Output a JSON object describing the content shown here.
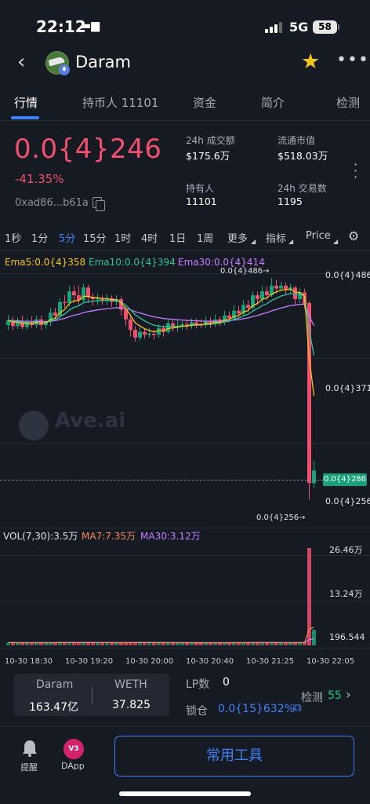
{
  "status_bar": {
    "time": "22:12",
    "network": "5G",
    "battery": "58"
  },
  "header": {
    "title": "Daram"
  },
  "tabs": [
    {
      "label": "行情"
    },
    {
      "label": "持币人 11101"
    },
    {
      "label": "资金"
    },
    {
      "label": "简介"
    },
    {
      "label": "检测"
    }
  ],
  "token": {
    "price": "0.0{4}246",
    "change": "-41.35%",
    "address": "0xad86...b61a"
  },
  "stats": {
    "volume_24h_label": "24h 成交额",
    "volume_24h": "$175.6万",
    "market_cap_label": "流通市值",
    "market_cap": "$518.03万",
    "holders_label": "持有人",
    "holders": "11101",
    "tx_24h_label": "24h 交易数",
    "tx_24h": "1195"
  },
  "timeframes": [
    "1秒",
    "1分",
    "5分",
    "15分",
    "1时",
    "4时",
    "1日",
    "1周",
    "更多",
    "指标",
    "Price"
  ],
  "active_timeframe": "5分",
  "chart_legend": {
    "ema5": "Ema5:0.0{4}358",
    "ema10": "Ema10:0.0{4}394",
    "ema30": "Ema30:0.0{4}414"
  },
  "price_axis": {
    "top": "0.0{4}486",
    "mid": "0.0{4}371",
    "bottom": "0.0{4}256",
    "current": "0.0{4}286"
  },
  "annotations": {
    "high": "0.0{4}486→",
    "low": "0.0{4}256→"
  },
  "watermark": "Ave.ai",
  "volume_legend": {
    "vol": "VOL(7,30):3.5万",
    "ma7": "MA7:7.35万",
    "ma30": "MA30:3.12万"
  },
  "volume_axis": {
    "top": "26.46万",
    "mid": "13.24万",
    "bottom": "196.544"
  },
  "time_axis": [
    "10-30 18:30",
    "10-30 19:20",
    "10-30 20:00",
    "10-30 20:40",
    "10-30 21:25",
    "10-30 22:05"
  ],
  "pool": {
    "token_a_label": "Daram",
    "token_a_value": "163.47亿",
    "token_b_label": "WETH",
    "token_b_value": "37.825",
    "lp_label": "LP数",
    "lp_value": "0",
    "lock_label": "锁仓",
    "lock_value": "0.0{15}632%",
    "check_label": "检测",
    "check_value": "55"
  },
  "bottom_nav": {
    "alert_label": "提醒",
    "dapp_label": "DApp",
    "dapp_badge": "V3",
    "tools_button": "常用工具"
  },
  "colors": {
    "up": "#16a37a",
    "down": "#f0506e",
    "accent": "#3b82f6",
    "ema5": "#f5c518",
    "ema10": "#2ec4a0",
    "ema30": "#c77dff"
  },
  "chart_data": {
    "type": "candlestick",
    "candles": [
      [
        4.37e-05,
        4.42e-05,
        4.48e-05,
        4.32e-05
      ],
      [
        4.42e-05,
        4.36e-05,
        4.46e-05,
        4.32e-05
      ],
      [
        4.36e-05,
        4.41e-05,
        4.45e-05,
        4.33e-05
      ],
      [
        4.41e-05,
        4.35e-05,
        4.47e-05,
        4.33e-05
      ],
      [
        4.35e-05,
        4.4e-05,
        4.44e-05,
        4.32e-05
      ],
      [
        4.4e-05,
        4.37e-05,
        4.46e-05,
        4.34e-05
      ],
      [
        4.37e-05,
        4.43e-05,
        4.47e-05,
        4.34e-05
      ],
      [
        4.43e-05,
        4.37e-05,
        4.47e-05,
        4.32e-05
      ],
      [
        4.37e-05,
        4.4e-05,
        4.43e-05,
        4.33e-05
      ],
      [
        4.4e-05,
        4.5e-05,
        4.55e-05,
        4.36e-05
      ],
      [
        4.5e-05,
        4.47e-05,
        4.55e-05,
        4.43e-05
      ],
      [
        4.47e-05,
        4.61e-05,
        4.65e-05,
        4.44e-05
      ],
      [
        4.61e-05,
        4.6e-05,
        4.68e-05,
        4.55e-05
      ],
      [
        4.6e-05,
        4.72e-05,
        4.78e-05,
        4.56e-05
      ],
      [
        4.72e-05,
        4.68e-05,
        4.78e-05,
        4.6e-05
      ],
      [
        4.68e-05,
        4.63e-05,
        4.78e-05,
        4.58e-05
      ],
      [
        4.63e-05,
        4.76e-05,
        4.8e-05,
        4.6e-05
      ],
      [
        4.76e-05,
        4.66e-05,
        4.79e-05,
        4.6e-05
      ],
      [
        4.66e-05,
        4.64e-05,
        4.7e-05,
        4.57e-05
      ],
      [
        4.64e-05,
        4.65e-05,
        4.7e-05,
        4.58e-05
      ],
      [
        4.65e-05,
        4.62e-05,
        4.68e-05,
        4.58e-05
      ],
      [
        4.62e-05,
        4.65e-05,
        4.69e-05,
        4.58e-05
      ],
      [
        4.65e-05,
        4.61e-05,
        4.68e-05,
        4.56e-05
      ],
      [
        4.61e-05,
        4.64e-05,
        4.68e-05,
        4.57e-05
      ],
      [
        4.64e-05,
        4.53e-05,
        4.67e-05,
        4.47e-05
      ],
      [
        4.53e-05,
        4.43e-05,
        4.56e-05,
        4.36e-05
      ],
      [
        4.43e-05,
        4.32e-05,
        4.47e-05,
        4.25e-05
      ],
      [
        4.32e-05,
        4.24e-05,
        4.36e-05,
        4.2e-05
      ],
      [
        4.24e-05,
        4.3e-05,
        4.35e-05,
        4.21e-05
      ],
      [
        4.3e-05,
        4.27e-05,
        4.34e-05,
        4.23e-05
      ],
      [
        4.27e-05,
        4.28e-05,
        4.34e-05,
        4.24e-05
      ],
      [
        4.28e-05,
        4.27e-05,
        4.32e-05,
        4.22e-05
      ],
      [
        4.27e-05,
        4.34e-05,
        4.38e-05,
        4.24e-05
      ],
      [
        4.34e-05,
        4.3e-05,
        4.37e-05,
        4.25e-05
      ],
      [
        4.3e-05,
        4.39e-05,
        4.44e-05,
        4.28e-05
      ],
      [
        4.39e-05,
        4.35e-05,
        4.42e-05,
        4.3e-05
      ],
      [
        4.35e-05,
        4.36e-05,
        4.42e-05,
        4.3e-05
      ],
      [
        4.36e-05,
        4.38e-05,
        4.41e-05,
        4.32e-05
      ],
      [
        4.38e-05,
        4.36e-05,
        4.43e-05,
        4.32e-05
      ],
      [
        4.36e-05,
        4.4e-05,
        4.44e-05,
        4.33e-05
      ],
      [
        4.4e-05,
        4.38e-05,
        4.44e-05,
        4.34e-05
      ],
      [
        4.38e-05,
        4.37e-05,
        4.43e-05,
        4.34e-05
      ],
      [
        4.37e-05,
        4.41e-05,
        4.46e-05,
        4.34e-05
      ],
      [
        4.41e-05,
        4.38e-05,
        4.45e-05,
        4.34e-05
      ],
      [
        4.38e-05,
        4.43e-05,
        4.48e-05,
        4.35e-05
      ],
      [
        4.43e-05,
        4.4e-05,
        4.46e-05,
        4.36e-05
      ],
      [
        4.4e-05,
        4.47e-05,
        4.52e-05,
        4.37e-05
      ],
      [
        4.47e-05,
        4.44e-05,
        4.51e-05,
        4.4e-05
      ],
      [
        4.44e-05,
        4.52e-05,
        4.58e-05,
        4.42e-05
      ],
      [
        4.52e-05,
        4.49e-05,
        4.57e-05,
        4.45e-05
      ],
      [
        4.49e-05,
        4.58e-05,
        4.63e-05,
        4.46e-05
      ],
      [
        4.58e-05,
        4.55e-05,
        4.63e-05,
        4.5e-05
      ],
      [
        4.55e-05,
        4.68e-05,
        4.72e-05,
        4.53e-05
      ],
      [
        4.68e-05,
        4.64e-05,
        4.72e-05,
        4.58e-05
      ],
      [
        4.64e-05,
        4.72e-05,
        4.78e-05,
        4.6e-05
      ],
      [
        4.72e-05,
        4.68e-05,
        4.77e-05,
        4.63e-05
      ],
      [
        4.68e-05,
        4.78e-05,
        4.86e-05,
        4.66e-05
      ],
      [
        4.78e-05,
        4.75e-05,
        4.84e-05,
        4.7e-05
      ],
      [
        4.75e-05,
        4.78e-05,
        4.82e-05,
        4.72e-05
      ],
      [
        4.78e-05,
        4.74e-05,
        4.81e-05,
        4.68e-05
      ],
      [
        4.74e-05,
        4.76e-05,
        4.8e-05,
        4.7e-05
      ],
      [
        4.76e-05,
        4.64e-05,
        4.78e-05,
        4.58e-05
      ],
      [
        4.64e-05,
        4.71e-05,
        4.75e-05,
        4.6e-05
      ],
      [
        4.71e-05,
        4.59e-05,
        4.75e-05,
        4.54e-05
      ],
      [
        4.6e-05,
        2.73e-05,
        4.62e-05,
        2.56e-05
      ],
      [
        2.73e-05,
        2.86e-05,
        2.96e-05,
        2.68e-05
      ]
    ],
    "ylim": [
      2.56e-05,
      4.86e-05
    ]
  }
}
